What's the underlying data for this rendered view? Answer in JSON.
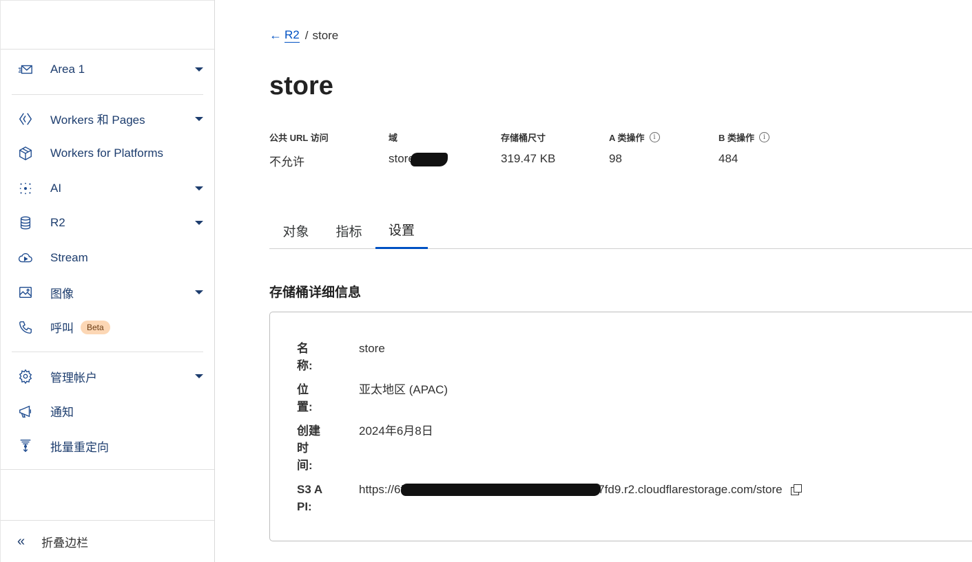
{
  "sidebar": {
    "groups": [
      [
        {
          "icon": "email-security-icon",
          "label": "Area 1",
          "caret": true
        }
      ],
      [
        {
          "icon": "workers-icon",
          "label": "Workers 和 Pages",
          "caret": true
        },
        {
          "icon": "platforms-box-icon",
          "label": "Workers for Platforms",
          "caret": false
        },
        {
          "icon": "ai-sparkle-icon",
          "label": "AI",
          "caret": true
        },
        {
          "icon": "database-icon",
          "label": "R2",
          "caret": true
        },
        {
          "icon": "stream-cloud-icon",
          "label": "Stream",
          "caret": false
        },
        {
          "icon": "image-icon",
          "label": "图像",
          "caret": true
        },
        {
          "icon": "phone-icon",
          "label": "呼叫",
          "caret": false,
          "badge": "Beta"
        }
      ],
      [
        {
          "icon": "gear-icon",
          "label": "管理帐户",
          "caret": true
        },
        {
          "icon": "megaphone-icon",
          "label": "通知",
          "caret": false
        },
        {
          "icon": "redirect-icon",
          "label": "批量重定向",
          "caret": false
        }
      ]
    ],
    "collapse_label": "折叠边栏"
  },
  "breadcrumb": {
    "parent": "R2",
    "current": "store"
  },
  "page_title": "store",
  "stats": [
    {
      "key": "公共 URL 访问",
      "value": "不允许",
      "info": false
    },
    {
      "key": "域",
      "value": "store",
      "info": false,
      "redacted": true
    },
    {
      "key": "存储桶尺寸",
      "value": "319.47 KB",
      "info": false
    },
    {
      "key": "A 类操作",
      "value": "98",
      "info": true
    },
    {
      "key": "B 类操作",
      "value": "484",
      "info": true
    }
  ],
  "tabs": [
    {
      "label": "对象",
      "active": false
    },
    {
      "label": "指标",
      "active": false
    },
    {
      "label": "设置",
      "active": true
    }
  ],
  "details": {
    "title": "存储桶详细信息",
    "rows": [
      {
        "key": "名称:",
        "value": "store"
      },
      {
        "key": "位置:",
        "value": "亚太地区 (APAC)"
      },
      {
        "key": "创建时间:",
        "value": "2024年6月8日"
      },
      {
        "key": "S3 API:",
        "value_prefix": "https://6f",
        "value_suffix": "7fd9.r2.cloudflarestorage.com/store"
      }
    ]
  },
  "colors": {
    "accent": "#0051c3",
    "nav_text": "#1d3d6e",
    "beta_badge": "#fcd7b5"
  }
}
